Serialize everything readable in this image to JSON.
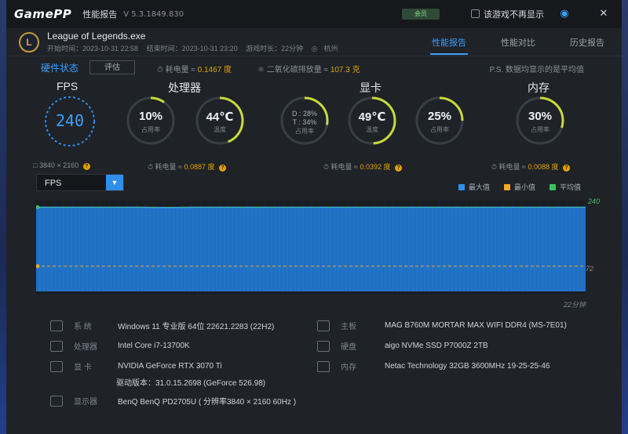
{
  "titlebar": {
    "logo": "GamePP",
    "title": "性能报告",
    "version": "V 5.3.1849.830",
    "badge": "会员",
    "hide_label": "该游戏不再显示",
    "camera_icon": "camera-icon",
    "close_icon": "close-icon"
  },
  "header": {
    "game_name": "League of Legends.exe",
    "start_time": "开始时间：2023-10-31 22:58",
    "end_time": "结束时间：2023-10-31 23:20",
    "duration": "游戏时长：22分钟",
    "location": "杭州",
    "tabs": [
      {
        "label": "性能报告",
        "active": true
      },
      {
        "label": "性能对比",
        "active": false
      },
      {
        "label": "历史报告",
        "active": false
      }
    ]
  },
  "hardware": {
    "title": "硬件状态",
    "eval_button": "评估",
    "total_power_label": "耗电量 ≈",
    "total_power_value": "0.1467 度",
    "co2_label": "二氧化碳排放量 ≈",
    "co2_value": "107.3 克",
    "note": "P.S. 数据均显示的是平均值"
  },
  "gauges": {
    "fps": {
      "title": "FPS",
      "value": "240",
      "resolution": "3840 × 2160"
    },
    "cpu": {
      "title": "处理器",
      "usage": {
        "value": "10%",
        "label": "占用率",
        "fraction": 0.1
      },
      "temp": {
        "value": "44℃",
        "label": "温度",
        "fraction": 0.44
      },
      "power_label": "耗电量 ≈",
      "power_value": "0.0887 度"
    },
    "gpu": {
      "title": "显卡",
      "d_usage": {
        "line1": "D : 28%",
        "line2": "T : 34%",
        "label": "占用率"
      },
      "temp": {
        "value": "49℃",
        "label": "温度",
        "fraction": 0.49
      },
      "usage": {
        "value": "25%",
        "label": "占用率",
        "fraction": 0.25
      },
      "power_label": "耗电量 ≈",
      "power_value": "0.0392 度"
    },
    "ram": {
      "title": "内存",
      "usage": {
        "value": "30%",
        "label": "占用率",
        "fraction": 0.3
      },
      "power_label": "耗电量 ≈",
      "power_value": "0.0088 度"
    }
  },
  "chart": {
    "selector": "FPS",
    "legend": [
      {
        "name": "最大值",
        "color": "#2f8fea"
      },
      {
        "name": "最小值",
        "color": "#f0a830"
      },
      {
        "name": "平均值",
        "color": "#3fbf5a"
      }
    ],
    "max_label": "240",
    "min_label": "72",
    "x_end_label": "22分钟"
  },
  "chart_data": {
    "type": "area",
    "series": [
      {
        "name": "FPS",
        "values": [
          240,
          240,
          240,
          240,
          240,
          239,
          240,
          240,
          240,
          240,
          240,
          240,
          240,
          240,
          240,
          240,
          240,
          240,
          240,
          240,
          240,
          240
        ]
      }
    ],
    "x": [
      1,
      2,
      3,
      4,
      5,
      6,
      7,
      8,
      9,
      10,
      11,
      12,
      13,
      14,
      15,
      16,
      17,
      18,
      19,
      20,
      21,
      22
    ],
    "ylim": [
      0,
      250
    ],
    "max": 240,
    "min": 72,
    "avg": 240
  },
  "sysinfo": [
    {
      "label": "系  统",
      "value": "Windows 11 专业版 64位 22621.2283 (22H2)",
      "icon": "windows-icon"
    },
    {
      "label": "处理器",
      "value": "Intel Core i7-13700K",
      "icon": "cpu-icon"
    },
    {
      "label": "显  卡",
      "value": "NVIDIA GeForce RTX 3070 Ti",
      "icon": "gpu-icon"
    },
    {
      "label": "",
      "value": "驱动版本：31.0.15.2698 (GeForce 526.98)",
      "icon": ""
    },
    {
      "label": "显示器",
      "value": "BenQ BenQ PD2705U ( 分辨率3840 × 2160 60Hz )",
      "icon": "monitor-icon"
    },
    {
      "label": "主板",
      "value": "MAG B760M MORTAR MAX WIFI DDR4 (MS-7E01)",
      "icon": "motherboard-icon"
    },
    {
      "label": "硬盘",
      "value": "aigo NVMe SSD P7000Z 2TB",
      "icon": "disk-icon"
    },
    {
      "label": "内存",
      "value": "Netac Technology 32GB 3600MHz 19-25-25-46",
      "icon": "ram-icon"
    }
  ]
}
